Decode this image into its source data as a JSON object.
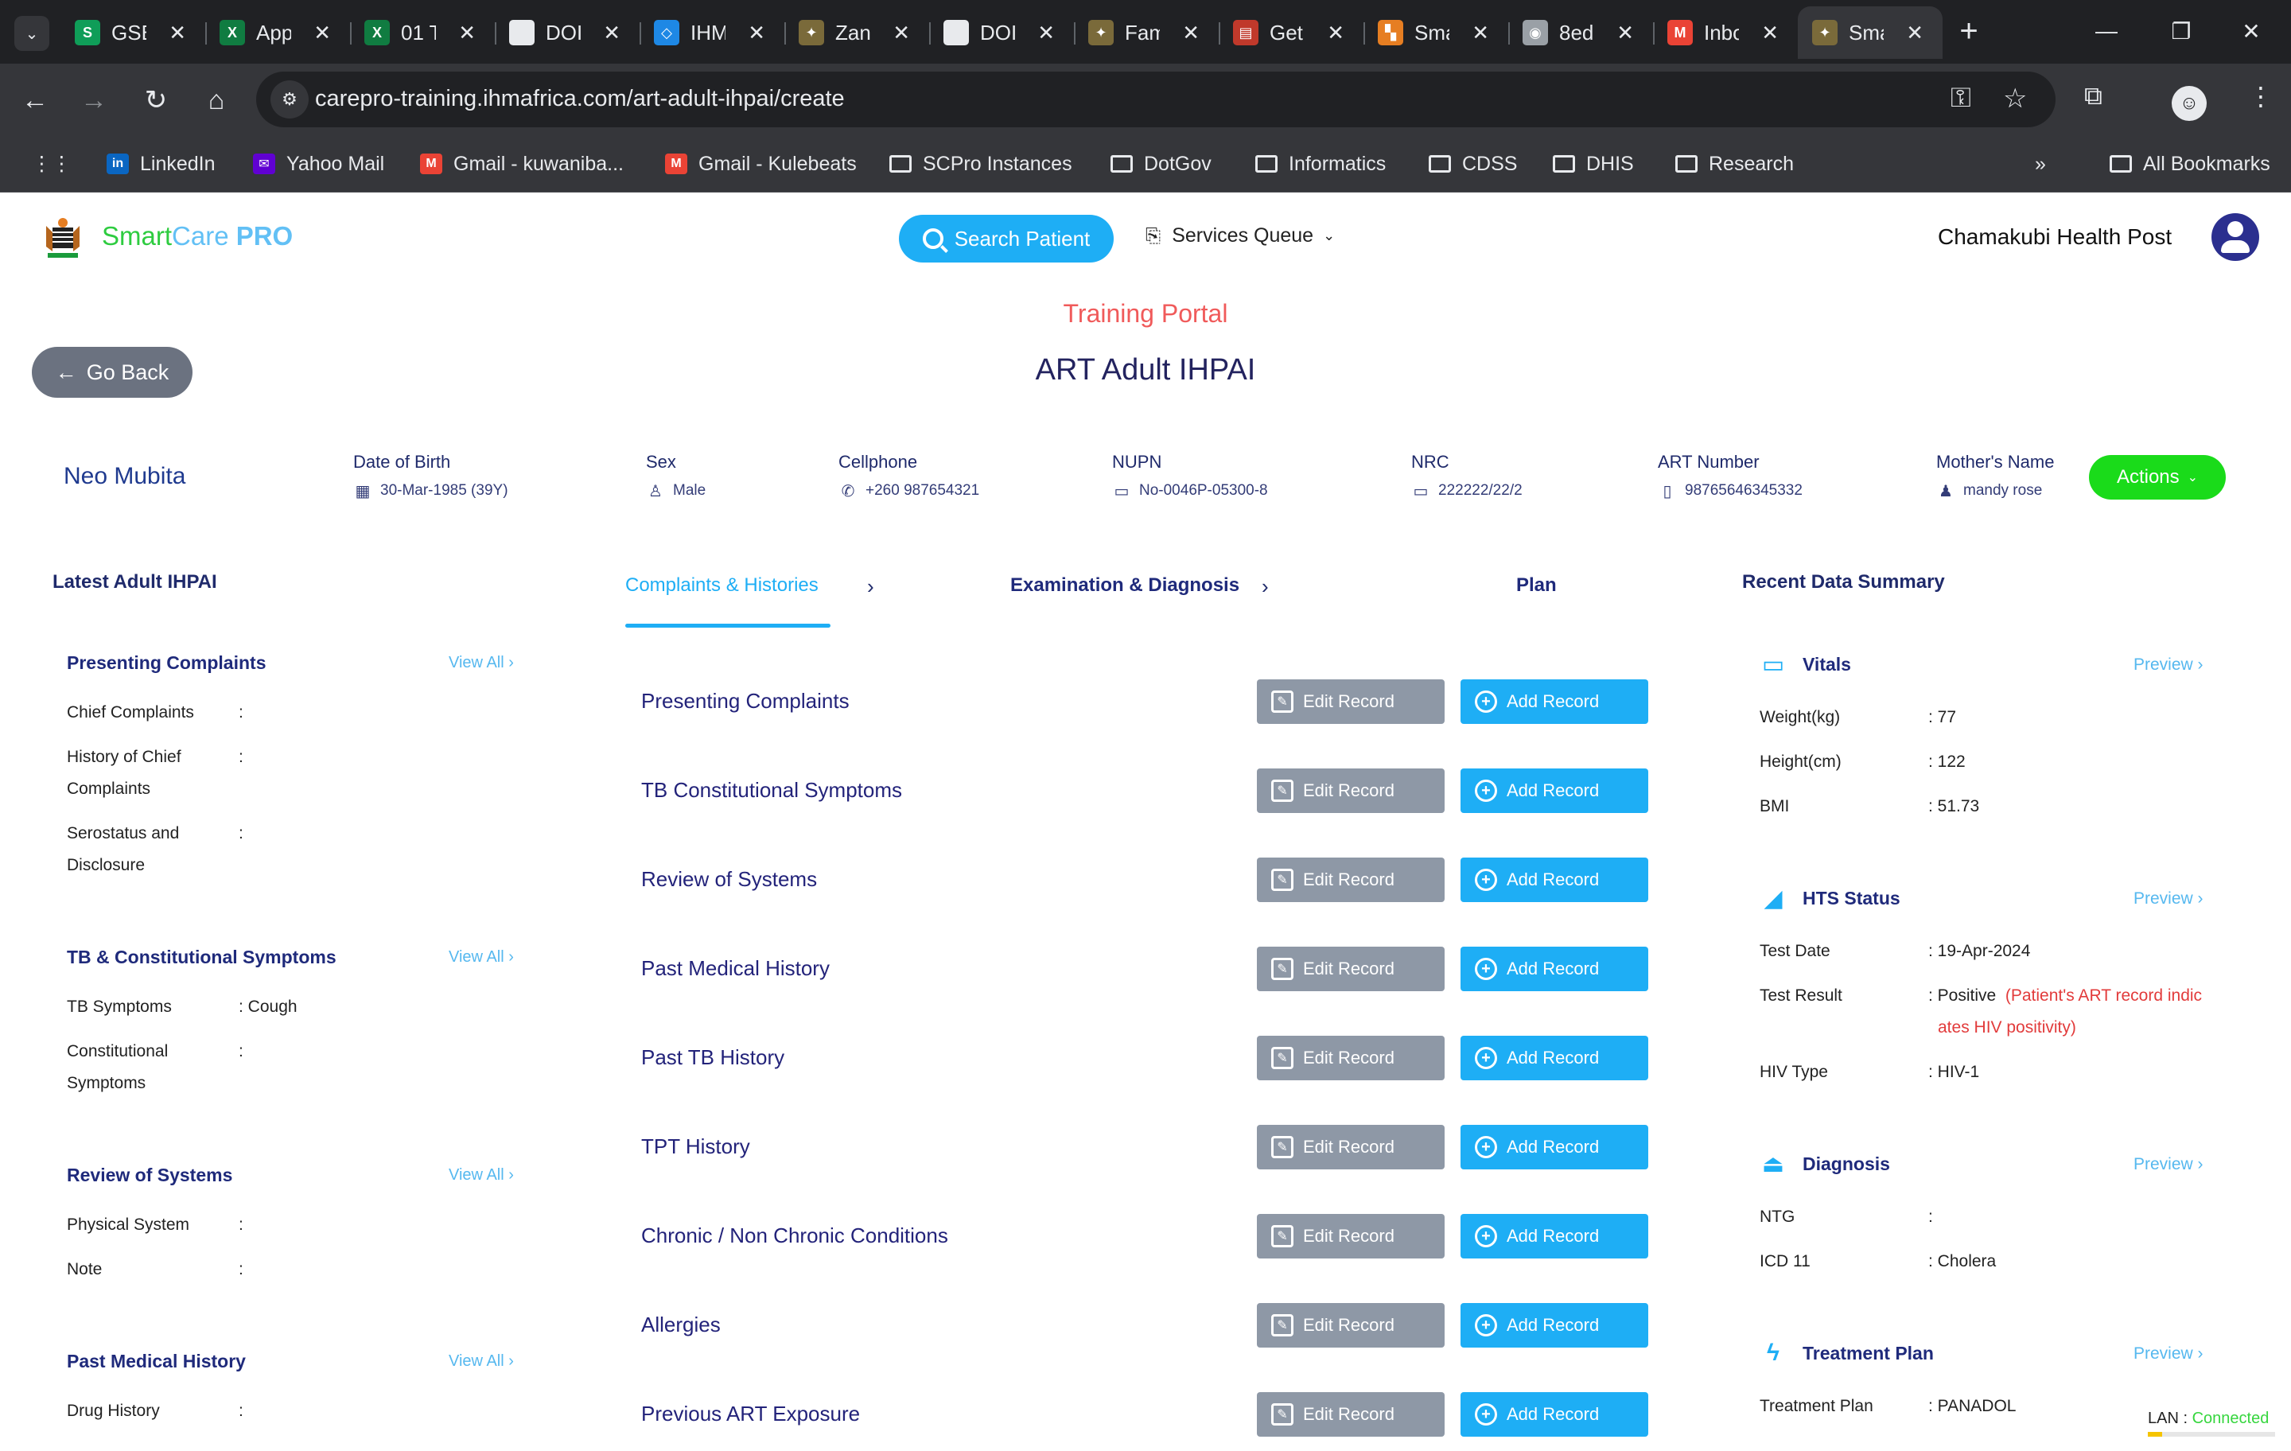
{
  "browser": {
    "tabs": [
      {
        "title": "GSB",
        "icon_label": "S",
        "icon_color": "#0f9d58",
        "active": false
      },
      {
        "title": "App",
        "icon_label": "X",
        "icon_color": "#107c41",
        "active": false
      },
      {
        "title": "01 T",
        "icon_label": "X",
        "icon_color": "#107c41",
        "active": false
      },
      {
        "title": "DOI",
        "icon_label": "",
        "icon_color": "#e8eaed",
        "active": false
      },
      {
        "title": "IHM",
        "icon_label": "◇",
        "icon_color": "#1e88e5",
        "active": false
      },
      {
        "title": "Zan",
        "icon_label": "✦",
        "icon_color": "#7a6a3a",
        "active": false
      },
      {
        "title": "DOI",
        "icon_label": "",
        "icon_color": "#e8eaed",
        "active": false
      },
      {
        "title": "Fam",
        "icon_label": "✦",
        "icon_color": "#7a6a3a",
        "active": false
      },
      {
        "title": "Get",
        "icon_label": "▤",
        "icon_color": "#c0392b",
        "active": false
      },
      {
        "title": "Sma",
        "icon_label": "▚",
        "icon_color": "#e67e22",
        "active": false
      },
      {
        "title": "8ed",
        "icon_label": "◉",
        "icon_color": "#9aa0a6",
        "active": false
      },
      {
        "title": "Inbo",
        "icon_label": "M",
        "icon_color": "#ea4335",
        "active": false
      },
      {
        "title": "Sma",
        "icon_label": "✦",
        "icon_color": "#7a6a3a",
        "active": true
      }
    ],
    "url": "carepro-training.ihmafrica.com/art-adult-ihpai/create",
    "bookmarks": [
      {
        "label": "LinkedIn",
        "icon": "linkedin-icon"
      },
      {
        "label": "Yahoo Mail",
        "icon": "yahoo-icon"
      },
      {
        "label": "Gmail - kuwaniba...",
        "icon": "gmail-icon"
      },
      {
        "label": "Gmail - Kulebeats",
        "icon": "gmail-icon"
      },
      {
        "label": "SCPro Instances",
        "icon": "folder-icon"
      },
      {
        "label": "DotGov",
        "icon": "folder-icon"
      },
      {
        "label": "Informatics",
        "icon": "folder-icon"
      },
      {
        "label": "CDSS",
        "icon": "folder-icon"
      },
      {
        "label": "DHIS",
        "icon": "folder-icon"
      },
      {
        "label": "Research",
        "icon": "folder-icon"
      }
    ],
    "all_bookmarks": "All Bookmarks"
  },
  "header": {
    "brand_smart": "Smart",
    "brand_care": "Care",
    "brand_pro": "PRO",
    "search_label": "Search Patient",
    "queue_label": "Services Queue",
    "facility": "Chamakubi Health Post"
  },
  "page": {
    "portal": "Training Portal",
    "title": "ART Adult IHPAI",
    "go_back": "Go Back"
  },
  "patient": {
    "name": "Neo Mubita",
    "dob_label": "Date of Birth",
    "dob": "30-Mar-1985 (39Y)",
    "sex_label": "Sex",
    "sex": "Male",
    "phone_label": "Cellphone",
    "phone": "+260 987654321",
    "nupn_label": "NUPN",
    "nupn": "No-0046P-05300-8",
    "nrc_label": "NRC",
    "nrc": "222222/22/2",
    "art_label": "ART Number",
    "art": "98765646345332",
    "mother_label": "Mother's Name",
    "mother": "mandy rose",
    "actions": "Actions"
  },
  "left": {
    "title": "Latest Adult IHPAI",
    "view_all": "View All",
    "sections": {
      "presenting": {
        "title": "Presenting Complaints",
        "rows": [
          {
            "label": "Chief Complaints",
            "value": ""
          },
          {
            "label": "History of Chief Complaints",
            "value": ""
          },
          {
            "label": "Serostatus and Disclosure",
            "value": ""
          }
        ]
      },
      "tb": {
        "title": "TB & Constitutional Symptoms",
        "rows": [
          {
            "label": "TB Symptoms",
            "value": ": Cough"
          },
          {
            "label": "Constitutional Symptoms",
            "value": ""
          }
        ]
      },
      "ros": {
        "title": "Review of Systems",
        "rows": [
          {
            "label": "Physical System",
            "value": ""
          },
          {
            "label": "Note",
            "value": ""
          }
        ]
      },
      "pmh": {
        "title": "Past Medical History",
        "rows": [
          {
            "label": "Drug History",
            "value": ""
          }
        ]
      }
    }
  },
  "center": {
    "tabs": [
      "Complaints & Histories",
      "Examination & Diagnosis",
      "Plan"
    ],
    "edit_label": "Edit Record",
    "add_label": "Add Record",
    "records": [
      "Presenting Complaints",
      "TB Constitutional Symptoms",
      "Review of Systems",
      "Past Medical History",
      "Past TB History",
      "TPT History",
      "Chronic / Non Chronic Conditions",
      "Allergies",
      "Previous ART Exposure"
    ]
  },
  "right": {
    "title": "Recent Data Summary",
    "preview": "Preview",
    "vitals": {
      "title": "Vitals",
      "rows": [
        {
          "label": "Weight(kg)",
          "value": ": 77"
        },
        {
          "label": "Height(cm)",
          "value": ": 122"
        },
        {
          "label": "BMI",
          "value": ": 51.73"
        }
      ]
    },
    "hts": {
      "title": "HTS Status",
      "test_date_label": "Test Date",
      "test_date": ": 19-Apr-2024",
      "test_result_label": "Test Result",
      "test_result": ": Positive",
      "note_line1": "(Patient's ART record indic",
      "note_line2": "ates HIV positivity)",
      "hiv_type_label": "HIV Type",
      "hiv_type": ": HIV-1"
    },
    "diagnosis": {
      "title": "Diagnosis",
      "rows": [
        {
          "label": "NTG",
          "value": ":"
        },
        {
          "label": "ICD 11",
          "value": ": Cholera"
        }
      ]
    },
    "treatment": {
      "title": "Treatment Plan",
      "rows": [
        {
          "label": "Treatment Plan",
          "value": ": PANADOL"
        }
      ]
    }
  },
  "status": {
    "lan_label": "LAN :",
    "lan_value": "Connected"
  }
}
